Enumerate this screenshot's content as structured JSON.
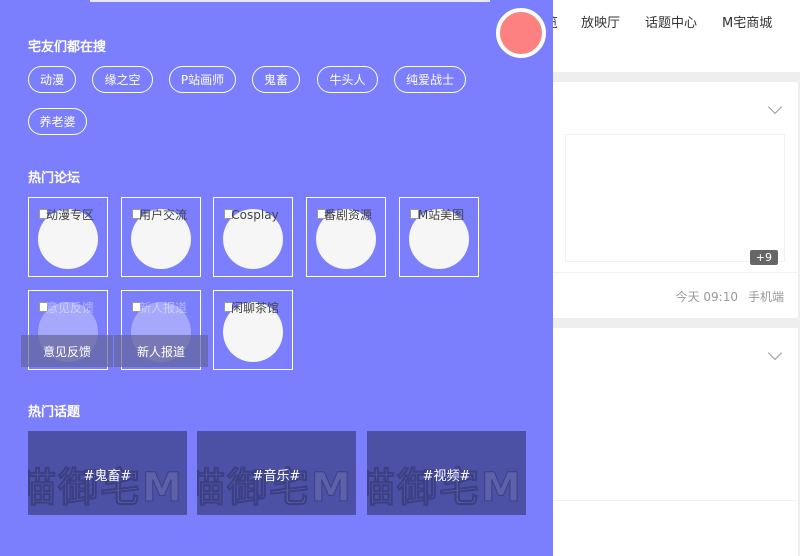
{
  "header": {
    "nav": [
      {
        "label": "览"
      },
      {
        "label": "放映厅"
      },
      {
        "label": "话题中心"
      },
      {
        "label": "M宅商城"
      }
    ]
  },
  "feed": {
    "post": {
      "more_count": "+9",
      "time": "今天 09:10",
      "source": "手机端"
    }
  },
  "drawer": {
    "search_title": "宅友们都在搜",
    "search_tags": [
      "动漫",
      "缘之空",
      "P站画师",
      "鬼畜",
      "牛头人",
      "纯爱战士",
      "养老婆"
    ],
    "forum_title": "热门论坛",
    "forums": [
      {
        "alt": "动漫专区"
      },
      {
        "alt": "用户交流"
      },
      {
        "alt": "Cosplay"
      },
      {
        "alt": "番剧资源"
      },
      {
        "alt": "M站美图"
      },
      {
        "alt": "意见反馈",
        "caption": "意见反馈"
      },
      {
        "alt": "新人报道",
        "caption": "新人报道"
      },
      {
        "alt": "闲聊茶馆"
      }
    ],
    "topic_title": "热门话题",
    "topics": [
      {
        "label": "#鬼畜#",
        "watermark": "喵御宅M"
      },
      {
        "label": "#音乐#",
        "watermark": "喵御宅M"
      },
      {
        "label": "#视频#",
        "watermark": "喵御宅M"
      }
    ]
  },
  "colors": {
    "drawer_bg": "#7b7ffd",
    "avatar": "#fd8180",
    "topic_bg": "#4d51a6"
  }
}
